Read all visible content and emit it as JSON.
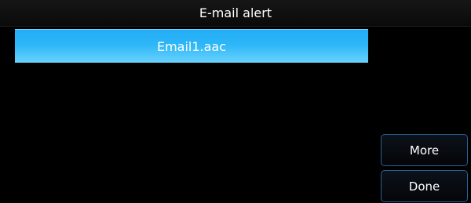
{
  "header": {
    "title": "E-mail alert"
  },
  "list": {
    "items": [
      {
        "label": "Email1.aac",
        "selected": true
      }
    ]
  },
  "actions": {
    "more_label": "More",
    "done_label": "Done"
  },
  "colors": {
    "background": "#000000",
    "selection": "#2db6f8",
    "button_border": "#2b5f92",
    "text": "#ffffff"
  }
}
